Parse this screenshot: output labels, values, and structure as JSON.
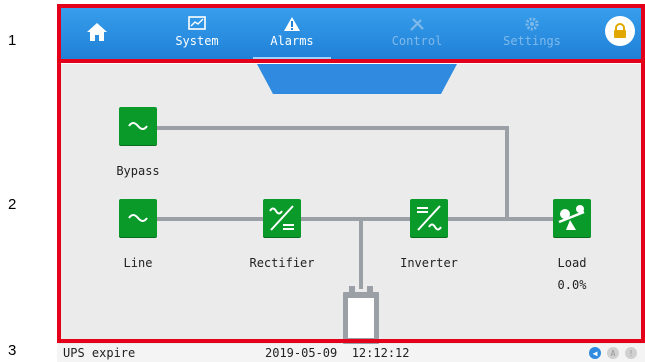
{
  "callouts": [
    "1",
    "2",
    "3"
  ],
  "nav": {
    "home_icon": "house-icon",
    "system": "System",
    "alarms": "Alarms",
    "control": "Control",
    "settings": "Settings",
    "lock_icon": "padlock-icon"
  },
  "diagram": {
    "bypass": "Bypass",
    "line": "Line",
    "rectifier": "Rectifier",
    "inverter": "Inverter",
    "load": "Load",
    "load_value": "0.0%"
  },
  "status": {
    "message": "UPS expire",
    "datetime": "2019-05-09  12:12:12"
  },
  "colors": {
    "nav_blue": "#1f80d6",
    "node_green": "#0a9a2a",
    "frame_red": "#e4001b",
    "mute_blue": "#2f8ae0"
  }
}
